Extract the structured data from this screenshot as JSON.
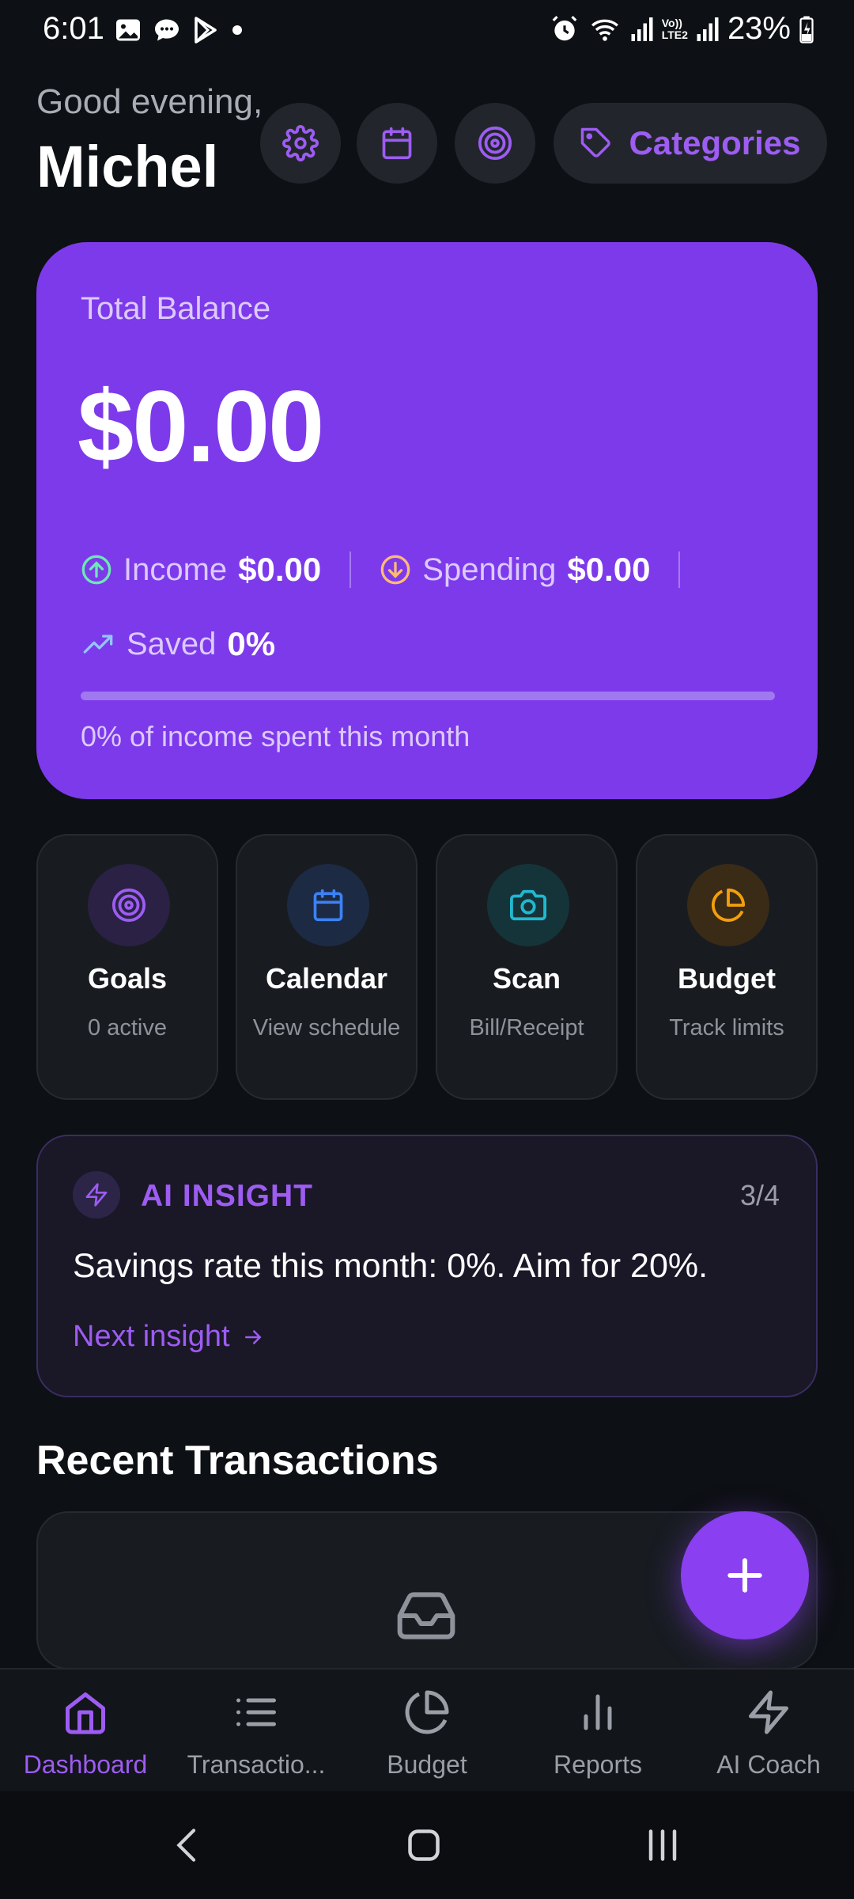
{
  "status_bar": {
    "time": "6:01",
    "battery": "23%",
    "icons": [
      "gallery-icon",
      "chat-icon",
      "play-store-icon",
      "dot-icon",
      "alarm-icon",
      "wifi-icon",
      "signal-icon",
      "volte-lte2-icon",
      "signal-icon",
      "battery-charging-icon"
    ],
    "lte_label_top": "Vo))",
    "lte_label_bottom": "LTE2"
  },
  "header": {
    "greeting": "Good evening,",
    "name": "Michel",
    "buttons": [
      "gear-icon",
      "calendar-icon",
      "target-icon"
    ],
    "categories_label": "Categories"
  },
  "balance": {
    "label": "Total Balance",
    "amount": "$0.00",
    "income_label": "Income",
    "income_value": "$0.00",
    "spending_label": "Spending",
    "spending_value": "$0.00",
    "saved_label": "Saved",
    "saved_value": "0%",
    "progress_fraction": 0,
    "footnote": "0% of income spent this month"
  },
  "quick_actions": [
    {
      "title": "Goals",
      "subtitle": "0 active",
      "icon": "target-icon",
      "color": "#9d5cf2"
    },
    {
      "title": "Calendar",
      "subtitle": "View schedule",
      "icon": "calendar-icon",
      "color": "#3b82f6"
    },
    {
      "title": "Scan",
      "subtitle": "Bill/Receipt",
      "icon": "camera-icon",
      "color": "#22b8cf"
    },
    {
      "title": "Budget",
      "subtitle": "Track limits",
      "icon": "pie-chart-icon",
      "color": "#f59e0b"
    }
  ],
  "insight": {
    "title": "AI INSIGHT",
    "counter": "3/4",
    "text": "Savings rate this month: 0%. Aim for 20%.",
    "next_label": "Next insight"
  },
  "recent": {
    "title": "Recent Transactions"
  },
  "bottom_nav": [
    {
      "label": "Dashboard",
      "icon": "home-icon",
      "active": true
    },
    {
      "label": "Transactio...",
      "icon": "list-icon",
      "active": false
    },
    {
      "label": "Budget",
      "icon": "pie-chart-icon",
      "active": false
    },
    {
      "label": "Reports",
      "icon": "bar-chart-icon",
      "active": false
    },
    {
      "label": "AI Coach",
      "icon": "lightning-icon",
      "active": false
    }
  ],
  "colors": {
    "accent": "#9d5cf2",
    "card_purple": "#7d3aea",
    "background": "#0d1014"
  }
}
